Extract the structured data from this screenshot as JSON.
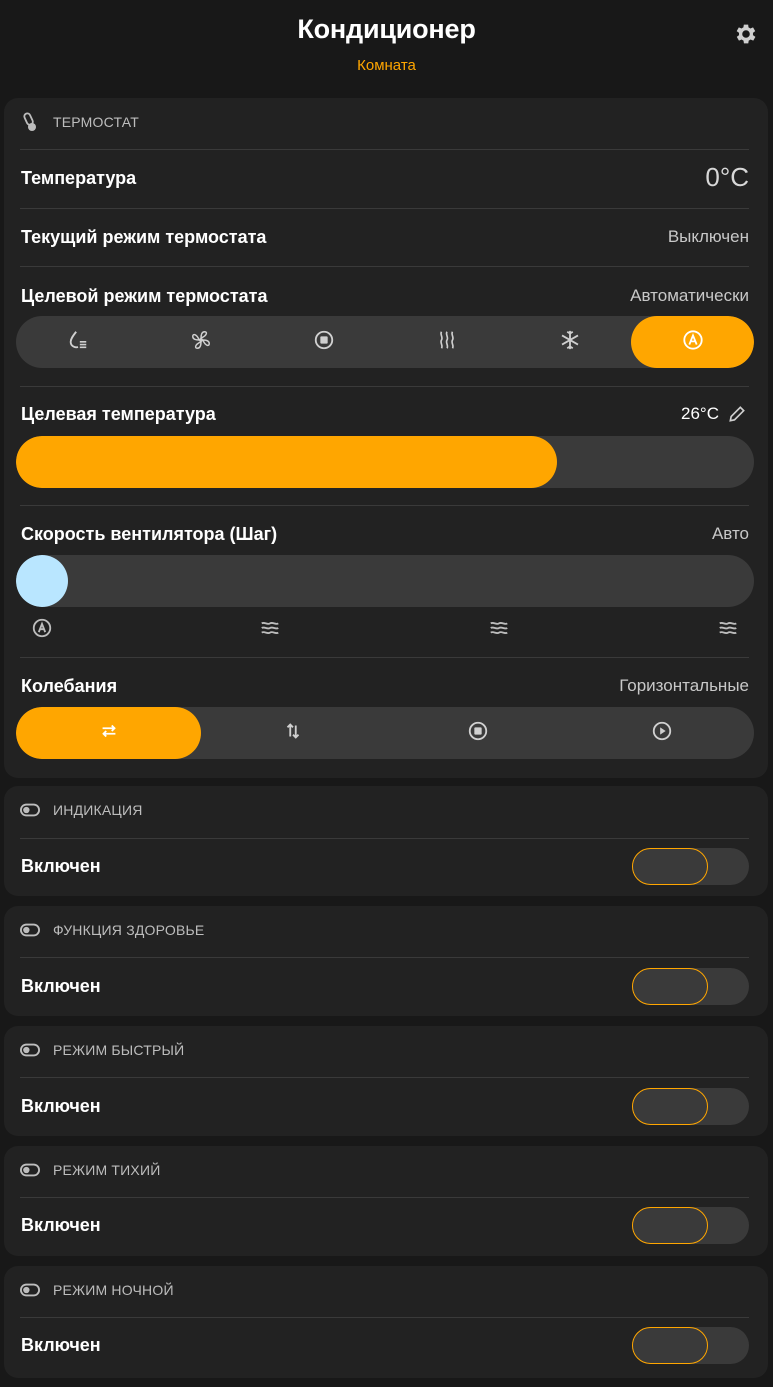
{
  "header": {
    "title": "Кондиционер",
    "subtitle": "Комната",
    "settings_icon": "gear-icon"
  },
  "thermostat": {
    "section_title": "ТЕРМОСТАТ",
    "section_icon": "thermometer-icon",
    "temperature_label": "Температура",
    "temperature_value": "0°C",
    "current_mode_label": "Текущий режим термостата",
    "current_mode_value": "Выключен",
    "target_mode_label": "Целевой режим термостата",
    "target_mode_value": "Автоматически",
    "target_modes": [
      {
        "icon": "dry-icon",
        "active": false
      },
      {
        "icon": "fan-icon",
        "active": false
      },
      {
        "icon": "off-icon",
        "active": false
      },
      {
        "icon": "heat-icon",
        "active": false
      },
      {
        "icon": "cool-icon",
        "active": false
      },
      {
        "icon": "auto-icon",
        "active": true
      }
    ],
    "target_temp_label": "Целевая температура",
    "target_temp_value": "26°C",
    "target_temp_fraction": 0.733,
    "fan_speed_label": "Скорость вентилятора (Шаг)",
    "fan_speed_value": "Авто",
    "fan_speed_steps": [
      "auto-icon",
      "wind-icon",
      "wind-icon",
      "wind-icon"
    ],
    "fan_speed_step_index": 0,
    "swing_label": "Колебания",
    "swing_value": "Горизонтальные",
    "swing_modes": [
      {
        "icon": "horizontal-arrows-icon",
        "active": true
      },
      {
        "icon": "vertical-arrows-icon",
        "active": false
      },
      {
        "icon": "stop-icon",
        "active": false
      },
      {
        "icon": "play-icon",
        "active": false
      }
    ]
  },
  "switches": [
    {
      "title": "ИНДИКАЦИЯ",
      "label": "Включен",
      "on": false
    },
    {
      "title": "ФУНКЦИЯ ЗДОРОВЬЕ",
      "label": "Включен",
      "on": false
    },
    {
      "title": "РЕЖИМ БЫСТРЫЙ",
      "label": "Включен",
      "on": false
    },
    {
      "title": "РЕЖИМ ТИХИЙ",
      "label": "Включен",
      "on": false
    },
    {
      "title": "РЕЖИМ НОЧНОЙ",
      "label": "Включен",
      "on": false
    }
  ],
  "colors": {
    "accent": "#ffa600",
    "card": "#222222",
    "background": "#181818",
    "track": "#3a3a3a",
    "fan_knob": "#b9e6ff"
  }
}
